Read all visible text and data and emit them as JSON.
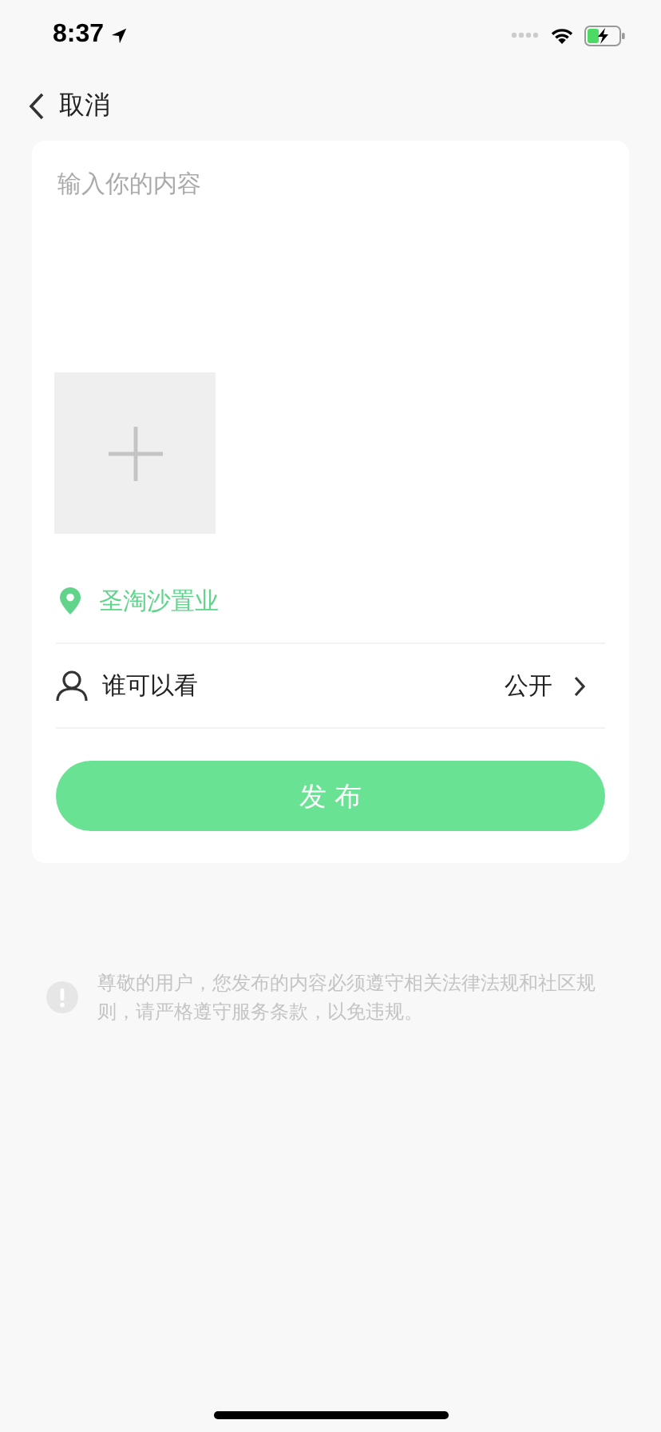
{
  "status_bar": {
    "time": "8:37"
  },
  "nav": {
    "back_label": "取消"
  },
  "composer": {
    "placeholder": "输入你的内容"
  },
  "location": {
    "label": "圣淘沙置业"
  },
  "visibility": {
    "label": "谁可以看",
    "value": "公开"
  },
  "publish_button": {
    "label": "发 布"
  },
  "notice": {
    "text": "尊敬的用户，您发布的内容必须遵守相关法律法规和社区规则，请严格遵守服务条款，以免违规。"
  }
}
